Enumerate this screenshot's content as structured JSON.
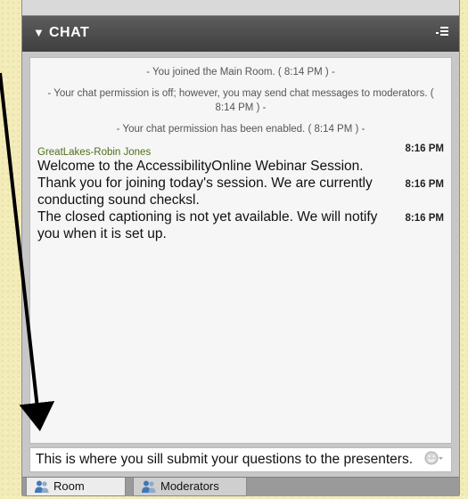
{
  "panel": {
    "title": "CHAT",
    "collapse_icon": "triangle-down-icon",
    "menu_icon": "list-menu-icon"
  },
  "chat": {
    "system_messages": [
      "- You joined the Main Room. ( 8:14 PM ) -",
      "- Your chat permission is off; however, you may send chat messages to moderators. ( 8:14 PM ) -",
      "- Your chat permission has been enabled. ( 8:14 PM ) -"
    ],
    "sender": "GreatLakes-Robin Jones",
    "messages": [
      {
        "time": "8:16 PM",
        "text": "Welcome to the AccessibilityOnline Webinar Session."
      },
      {
        "time": "8:16 PM",
        "text": "Thank you for joining today's session. We are currently conducting sound checksl."
      },
      {
        "time": "8:16 PM",
        "text": "The closed captioning is not yet available. We will notify you when it is set up."
      }
    ]
  },
  "input": {
    "value": "This is where you sill submit your questions to the presenters.",
    "emoji_icon": "smiley-icon"
  },
  "tabs": [
    {
      "label": "Room",
      "icon": "people-icon",
      "selected": true
    },
    {
      "label": "Moderators",
      "icon": "people-icon",
      "selected": false
    }
  ],
  "colors": {
    "background": "#f2ecb8",
    "header": "#4a4a4a",
    "sender": "#4f6e18",
    "arrow": "#000000"
  }
}
